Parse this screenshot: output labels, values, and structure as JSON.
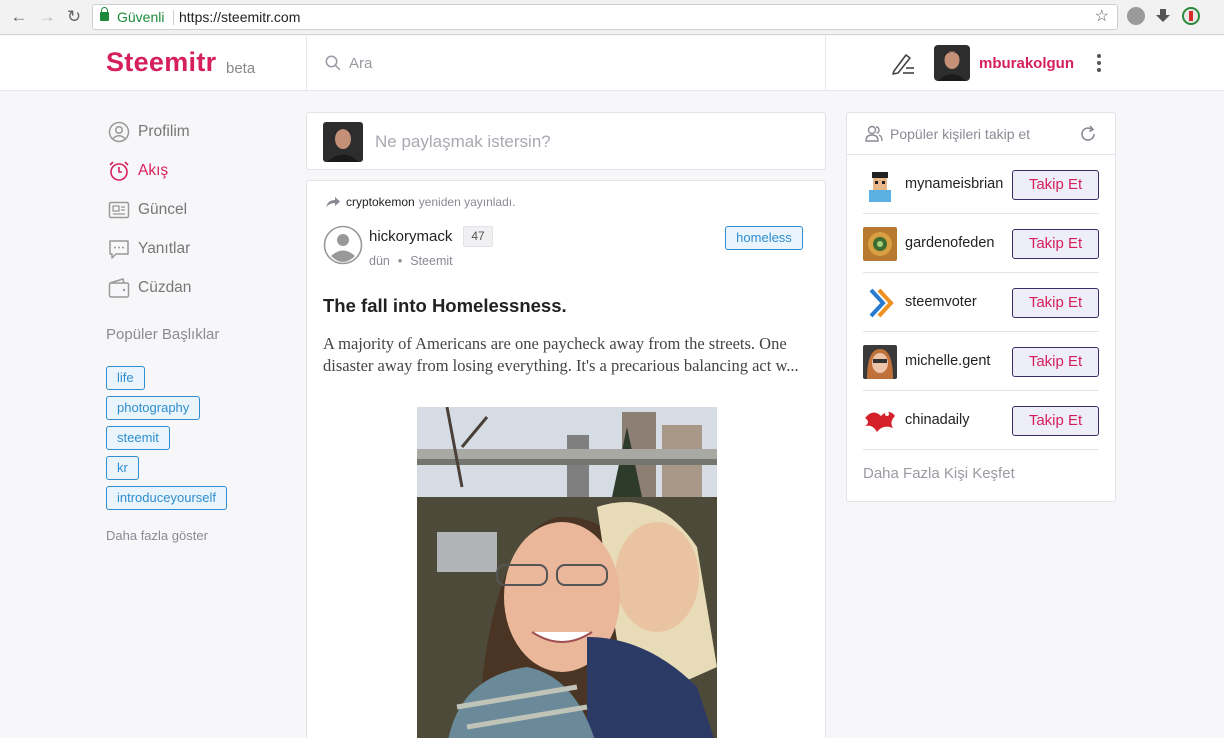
{
  "browser": {
    "secure_label": "Güvenli",
    "url": "https://steemitr.com"
  },
  "header": {
    "logo": "Steemitr",
    "logo_suffix": "beta",
    "search_placeholder": "Ara",
    "username": "mburakolgun"
  },
  "sidebar": {
    "items": [
      {
        "label": "Profilim",
        "icon": "user-circle-icon",
        "active": false
      },
      {
        "label": "Akış",
        "icon": "alarm-clock-icon",
        "active": true
      },
      {
        "label": "Güncel",
        "icon": "newspaper-icon",
        "active": false
      },
      {
        "label": "Yanıtlar",
        "icon": "chat-bubble-icon",
        "active": false
      },
      {
        "label": "Cüzdan",
        "icon": "wallet-icon",
        "active": false
      }
    ],
    "topics_title": "Popüler Başlıklar",
    "topics": [
      "life",
      "photography",
      "steemit",
      "kr",
      "introduceyourself"
    ],
    "show_more": "Daha fazla göster"
  },
  "composer": {
    "placeholder": "Ne paylaşmak istersin?"
  },
  "post": {
    "resteem_user": "cryptokemon",
    "resteem_text": "yeniden yayınladı.",
    "author": "hickorymack",
    "reputation": "47",
    "time": "dün",
    "app": "Steemit",
    "tag": "homeless",
    "title": "The fall into Homelessness.",
    "excerpt": "A majority of Americans are one paycheck away from the streets. One disaster away from losing everything. It's a precarious balancing act w..."
  },
  "follow_panel": {
    "title": "Popüler kişileri takip et",
    "button_label": "Takip Et",
    "users": [
      "mynameisbrian",
      "gardenofeden",
      "steemvoter",
      "michelle.gent",
      "chinadaily"
    ],
    "discover_more": "Daha Fazla Kişi Keşfet"
  },
  "colors": {
    "brand": "#d6205e",
    "tag_blue": "#2f8fd0",
    "secure_green": "#1d8a3b"
  }
}
